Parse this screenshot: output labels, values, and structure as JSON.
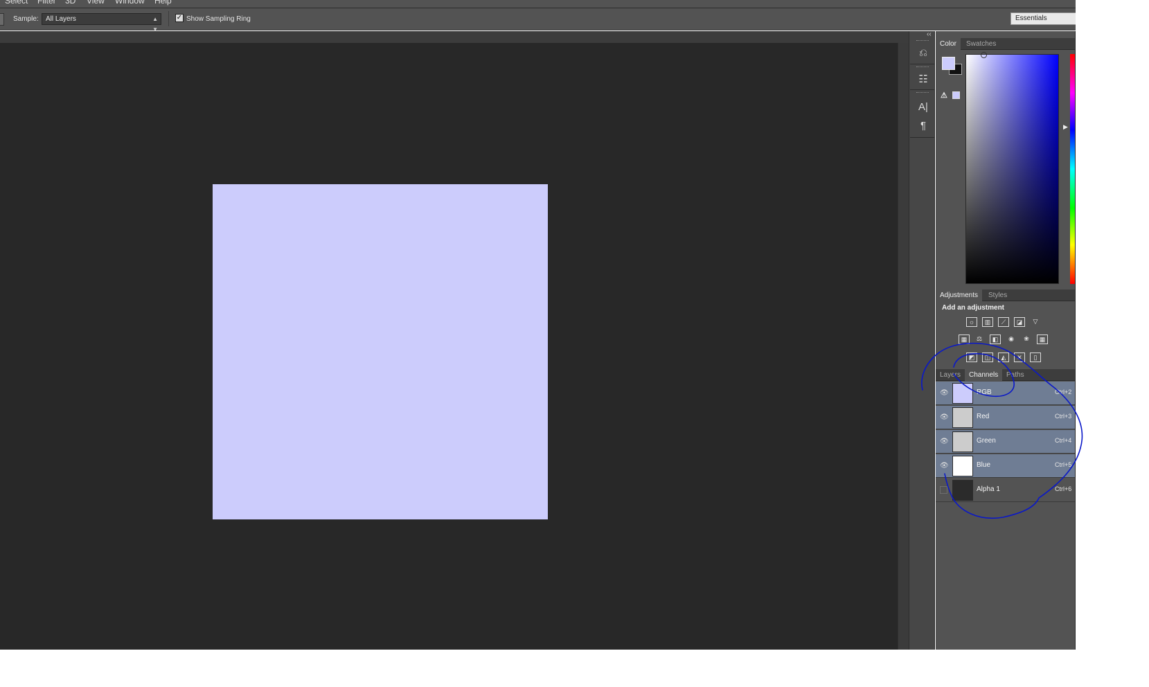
{
  "menu": {
    "items": [
      "Select",
      "Filter",
      "3D",
      "View",
      "Window",
      "Help"
    ]
  },
  "options_bar": {
    "sample_label": "Sample:",
    "sample_value": "All Layers",
    "show_sampling_ring_label": "Show Sampling Ring",
    "show_sampling_ring_checked": true,
    "workspace": "Essentials"
  },
  "document": {
    "fill_color": "#ccccfc"
  },
  "color_panel": {
    "tabs": [
      "Color",
      "Swatches"
    ],
    "active_tab": "Color",
    "foreground_color": "#ccccfc",
    "background_color": "#111111",
    "field_hue_color": "#0000ff"
  },
  "adjustments_panel": {
    "tabs": [
      "Adjustments",
      "Styles"
    ],
    "active_tab": "Adjustments",
    "title": "Add an adjustment",
    "icon_rows": [
      [
        "brightness-contrast-icon",
        "levels-icon",
        "curves-icon",
        "exposure-icon",
        "vibrance-icon"
      ],
      [
        "hue-saturation-icon",
        "color-balance-icon",
        "black-white-icon",
        "photo-filter-icon",
        "channel-mixer-icon",
        "color-lookup-icon"
      ],
      [
        "invert-icon",
        "posterize-icon",
        "threshold-icon",
        "selective-color-icon",
        "gradient-map-icon"
      ]
    ]
  },
  "channels_panel": {
    "tabs": [
      "Layers",
      "Channels",
      "Paths"
    ],
    "active_tab": "Channels",
    "channels": [
      {
        "name": "RGB",
        "shortcut": "Ctrl+2",
        "selected": true,
        "visible": true,
        "thumb": "#ccccfc"
      },
      {
        "name": "Red",
        "shortcut": "Ctrl+3",
        "selected": true,
        "visible": true,
        "thumb": "#cccccc"
      },
      {
        "name": "Green",
        "shortcut": "Ctrl+4",
        "selected": true,
        "visible": true,
        "thumb": "#cccccc"
      },
      {
        "name": "Blue",
        "shortcut": "Ctrl+5",
        "selected": true,
        "visible": true,
        "thumb": "#ffffff"
      },
      {
        "name": "Alpha 1",
        "shortcut": "Ctrl+6",
        "selected": false,
        "visible": false,
        "thumb": "#2b2b2b"
      }
    ]
  },
  "dock_icons": [
    "history-icon",
    "properties-icon",
    "character-icon",
    "paragraph-icon"
  ],
  "annotation": {
    "color": "#0a18c8"
  }
}
